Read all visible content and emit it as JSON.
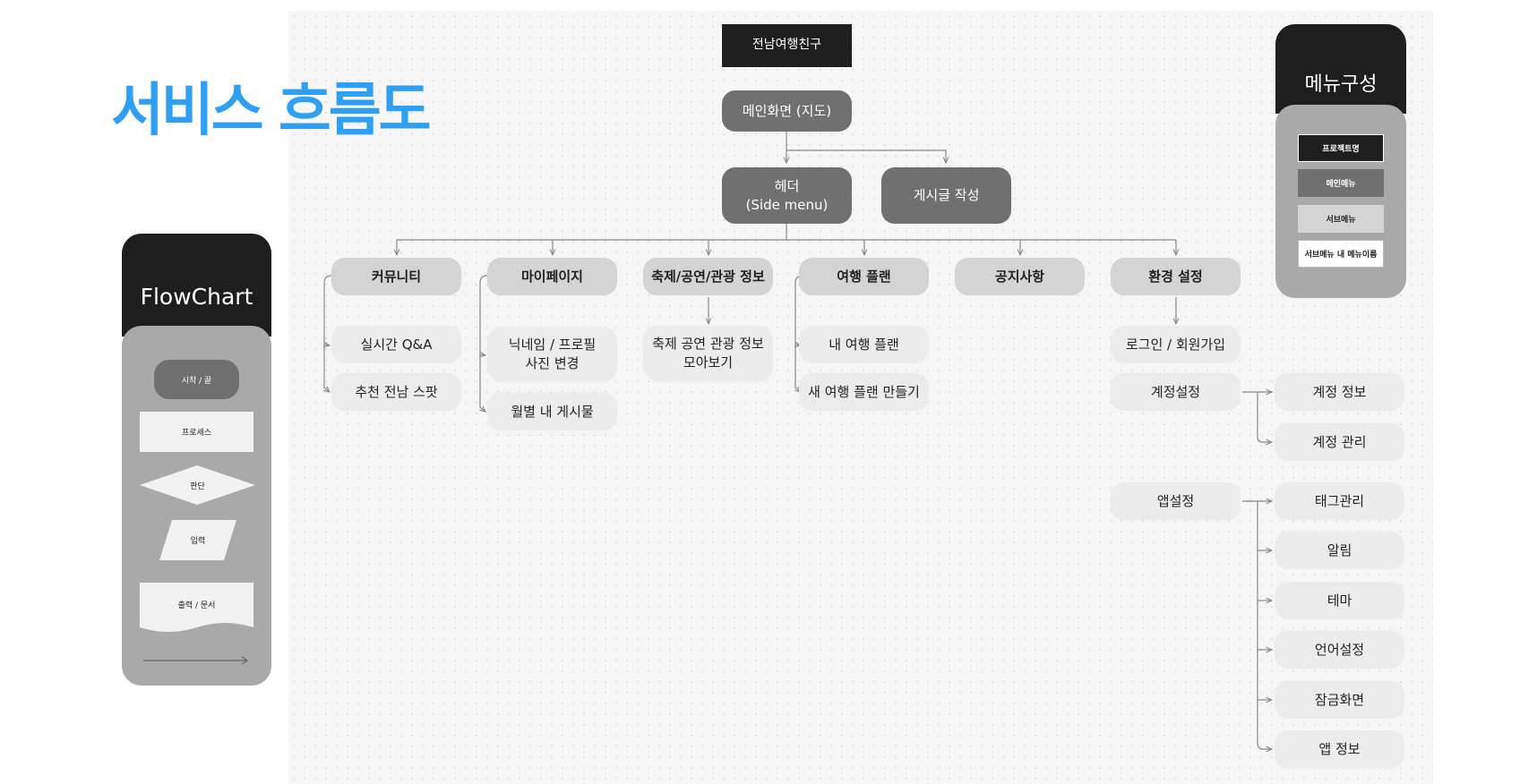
{
  "title": "서비스 흐름도",
  "flow": {
    "root": "전남여행친구",
    "main_screen": "메인화면 (지도)",
    "header": "헤더\n(Side menu)",
    "write_post": "게시글 작성",
    "categories": [
      "커뮤니티",
      "마이페이지",
      "축제/공연/관광 정보",
      "여행 플랜",
      "공지사항",
      "환경 설정"
    ],
    "community": [
      "실시간 Q&A",
      "추천 전남 스팟"
    ],
    "mypage": [
      "닉네임 / 프로필\n사진 변경",
      "월별 내 게시물"
    ],
    "festival": [
      "축제 공연 관광 정보\n모아보기"
    ],
    "travel_plan": [
      "내 여행 플랜",
      "새 여행 플랜 만들기"
    ],
    "settings": [
      "로그인 / 회원가입",
      "계정설정",
      "앱설정"
    ],
    "account_settings": [
      "계정 정보",
      "계정 관리"
    ],
    "app_settings": [
      "태그관리",
      "알림",
      "테마",
      "언어설정",
      "잠금화면",
      "앱 정보"
    ]
  },
  "flowchart_legend": {
    "title": "FlowChart",
    "terminal": "시작 / 끝",
    "process": "프로세스",
    "decision": "판단",
    "input": "입력",
    "output": "출력 / 문서"
  },
  "menu_legend": {
    "title": "메뉴구성",
    "project": "프로젝트명",
    "main_menu": "메인메뉴",
    "sub_menu": "서브메뉴",
    "sub_sub_menu": "서브메뉴 내 메뉴이름"
  },
  "colors": {
    "title_blue": "#2f9ff2",
    "top": "#1f1f1f",
    "main": "#707070",
    "sub": "#d4d4d4",
    "leaf": "#ececec",
    "line": "#888888"
  }
}
